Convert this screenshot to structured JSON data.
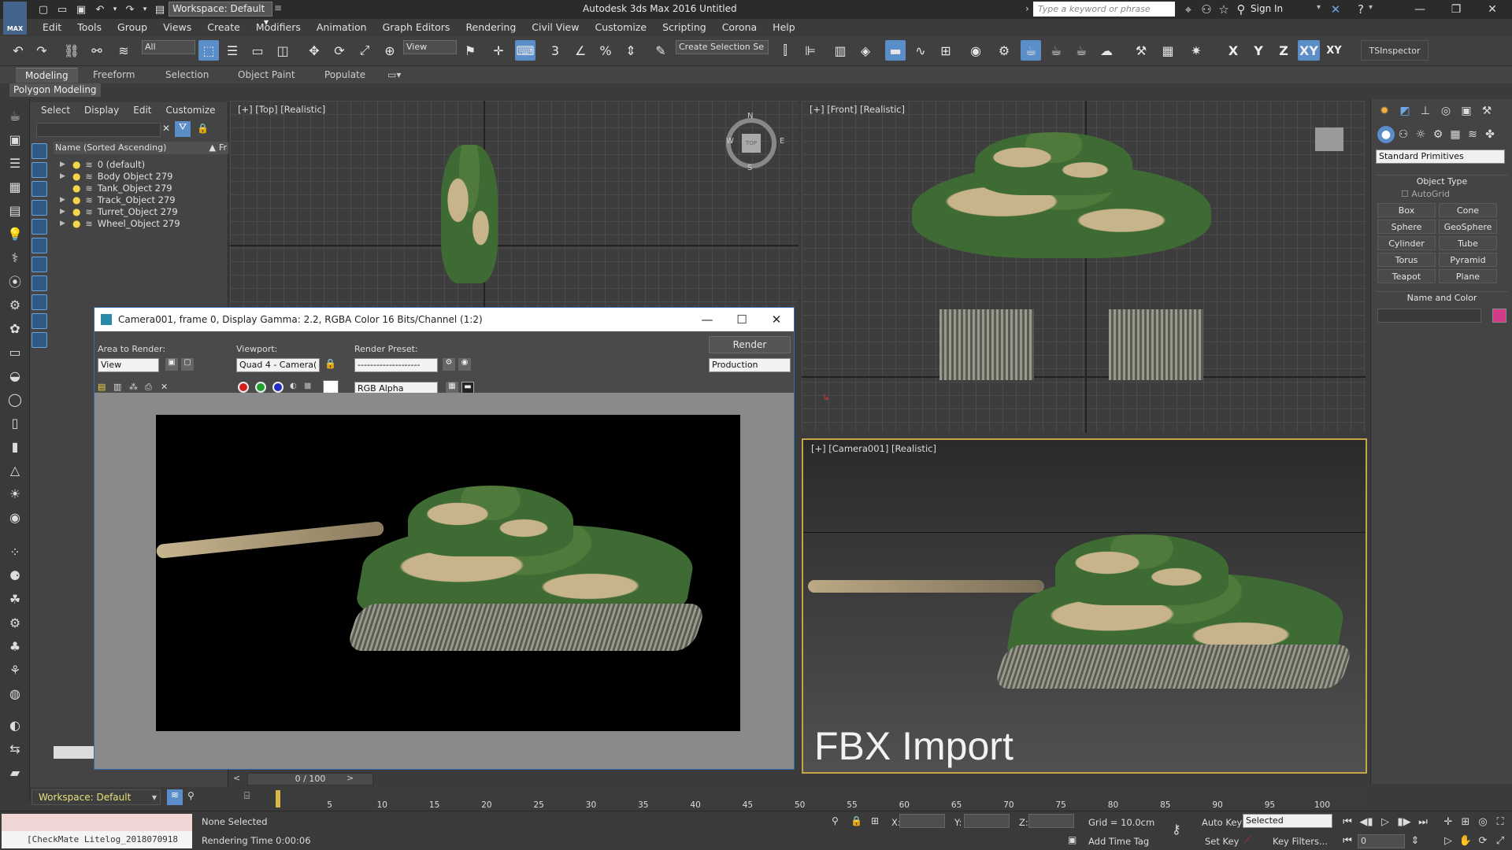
{
  "titlebar": {
    "workspace": "Workspace: Default",
    "app_title": "Autodesk 3ds Max 2016    Untitled",
    "search_placeholder": "Type a keyword or phrase",
    "signin": "Sign In",
    "logo_text": "MAX"
  },
  "menus": [
    "Edit",
    "Tools",
    "Group",
    "Views",
    "Create",
    "Modifiers",
    "Animation",
    "Graph Editors",
    "Rendering",
    "Civil View",
    "Customize",
    "Scripting",
    "Corona",
    "Help"
  ],
  "toolbar": {
    "selection_filter": "All",
    "ref_coord": "View",
    "named_selection": "Create Selection Se",
    "axis": [
      "X",
      "Y",
      "Z",
      "XY",
      "XY"
    ],
    "tsinspector": "TSInspector"
  },
  "ribbon": {
    "tabs": [
      "Modeling",
      "Freeform",
      "Selection",
      "Object Paint",
      "Populate"
    ],
    "sub": "Polygon Modeling"
  },
  "explorer": {
    "menu": [
      "Select",
      "Display",
      "Edit",
      "Customize"
    ],
    "header": "Name (Sorted Ascending)",
    "header_extra": "Fr",
    "layers": [
      "0 (default)",
      "Body Object 279",
      "Tank_Object 279",
      "Track_Object 279",
      "Turret_Object 279",
      "Wheel_Object 279"
    ],
    "workspace": "Workspace: Default"
  },
  "viewports": {
    "top": "[+] [Top] [Realistic]",
    "front": "[+] [Front] [Realistic]",
    "camera": "[+] [Camera001] [Realistic]",
    "fbx_label": "FBX Import",
    "viewcube_top": "TOP",
    "compass": {
      "n": "N",
      "s": "S",
      "e": "E",
      "w": "W"
    }
  },
  "render_window": {
    "title": "Camera001, frame 0, Display Gamma: 2.2, RGBA Color 16 Bits/Channel (1:2)",
    "area_label": "Area to Render:",
    "area_value": "View",
    "viewport_label": "Viewport:",
    "viewport_value": "Quad 4 - Camera(",
    "preset_label": "Render Preset:",
    "preset_value": "--------------------",
    "render_button": "Render",
    "production": "Production",
    "channel": "RGB Alpha"
  },
  "command_panel": {
    "dropdown": "Standard Primitives",
    "object_type": "Object Type",
    "autogrid": "AutoGrid",
    "buttons": [
      "Box",
      "Cone",
      "Sphere",
      "GeoSphere",
      "Cylinder",
      "Tube",
      "Torus",
      "Pyramid",
      "Teapot",
      "Plane"
    ],
    "name_color": "Name and Color",
    "color_swatch": "#d43a8a"
  },
  "timeline": {
    "frame": "0 / 100",
    "ticks": [
      "0",
      "5",
      "10",
      "15",
      "20",
      "25",
      "30",
      "35",
      "40",
      "45",
      "50",
      "55",
      "60",
      "65",
      "70",
      "75",
      "80",
      "85",
      "90",
      "95",
      "100"
    ]
  },
  "status": {
    "checkmate": "[CheckMate Litelog_2018070918",
    "none_selected": "None Selected",
    "rendering_time": "Rendering Time  0:00:06",
    "x": "X:",
    "y": "Y:",
    "z": "Z:",
    "grid": "Grid = 10.0cm",
    "add_time_tag": "Add Time Tag",
    "auto_key": "Auto Key",
    "set_key": "Set Key",
    "selected": "Selected",
    "key_filters": "Key Filters...",
    "frame_field": "0"
  },
  "colors": {
    "accent": "#5b8dc8",
    "camera_border": "#c7a44a",
    "layer_bulb": "#f4d64a"
  }
}
